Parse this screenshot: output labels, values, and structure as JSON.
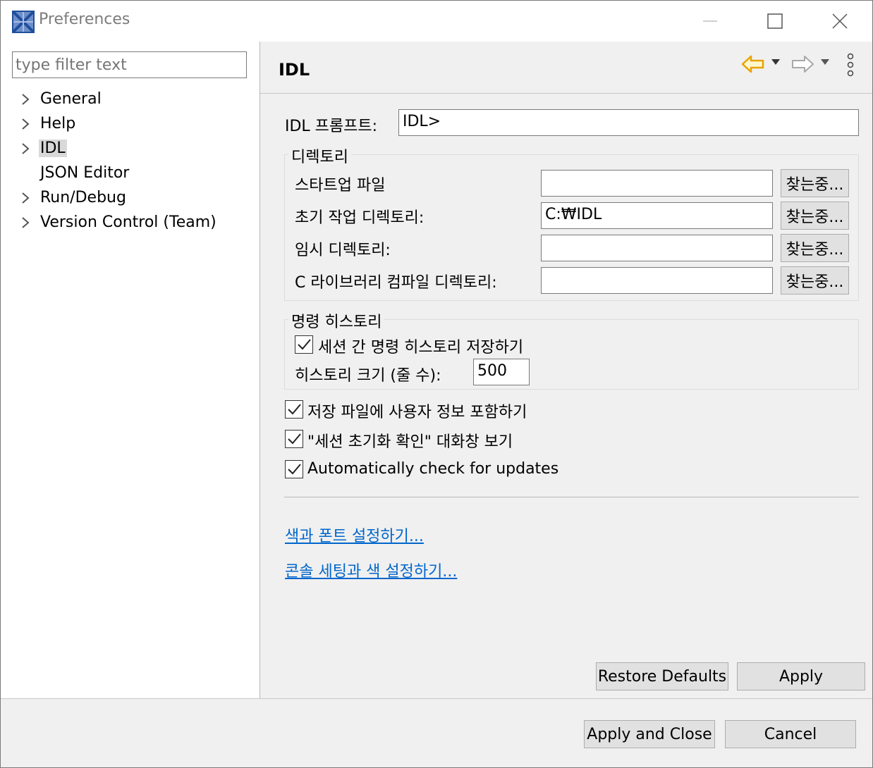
{
  "window": {
    "title": "Preferences",
    "icon": "eclipse-app-icon"
  },
  "sidebar": {
    "filter_placeholder": "type filter text",
    "items": [
      {
        "label": "General",
        "expandable": true,
        "selected": false
      },
      {
        "label": "Help",
        "expandable": true,
        "selected": false
      },
      {
        "label": "IDL",
        "expandable": true,
        "selected": true
      },
      {
        "label": "JSON Editor",
        "expandable": false,
        "selected": false
      },
      {
        "label": "Run/Debug",
        "expandable": true,
        "selected": false
      },
      {
        "label": "Version Control (Team)",
        "expandable": true,
        "selected": false
      }
    ]
  },
  "page": {
    "title": "IDL",
    "prompt_label": "IDL 프롬프트:",
    "prompt_value": "IDL>",
    "directory_group": {
      "title": "디렉토리",
      "rows": [
        {
          "label": "스타트업 파일",
          "value": "",
          "button": "찾는중..."
        },
        {
          "label": "초기 작업 디렉토리:",
          "value": "C:₩IDL",
          "button": "찾는중..."
        },
        {
          "label": "임시 디렉토리:",
          "value": "",
          "button": "찾는중..."
        },
        {
          "label": "C 라이브러리 컴파일 디렉토리:",
          "value": "",
          "button": "찾는중..."
        }
      ]
    },
    "history_group": {
      "title": "명령 히스토리",
      "save_history_label": "세션 간 명령 히스토리 저장하기",
      "save_history_checked": true,
      "size_label": "히스토리 크기 (줄 수):",
      "size_value": "500"
    },
    "options": [
      {
        "label": "저장 파일에 사용자 정보 포함하기",
        "checked": true
      },
      {
        "label": "\"세션 초기화 확인\" 대화창 보기",
        "checked": true
      },
      {
        "label": "Automatically check for updates",
        "checked": true
      }
    ],
    "links": {
      "colors_fonts": "색과 폰트 설정하기...",
      "console": "콘솔 세팅과 색 설정하기..."
    },
    "restore_defaults": "Restore Defaults",
    "apply": "Apply"
  },
  "footer": {
    "apply_close": "Apply and Close",
    "cancel": "Cancel"
  },
  "colors": {
    "link": "#0066cc",
    "panel_bg": "#f0f0f0",
    "selection": "#d9d9d9",
    "back_arrow": "#e8a300"
  }
}
